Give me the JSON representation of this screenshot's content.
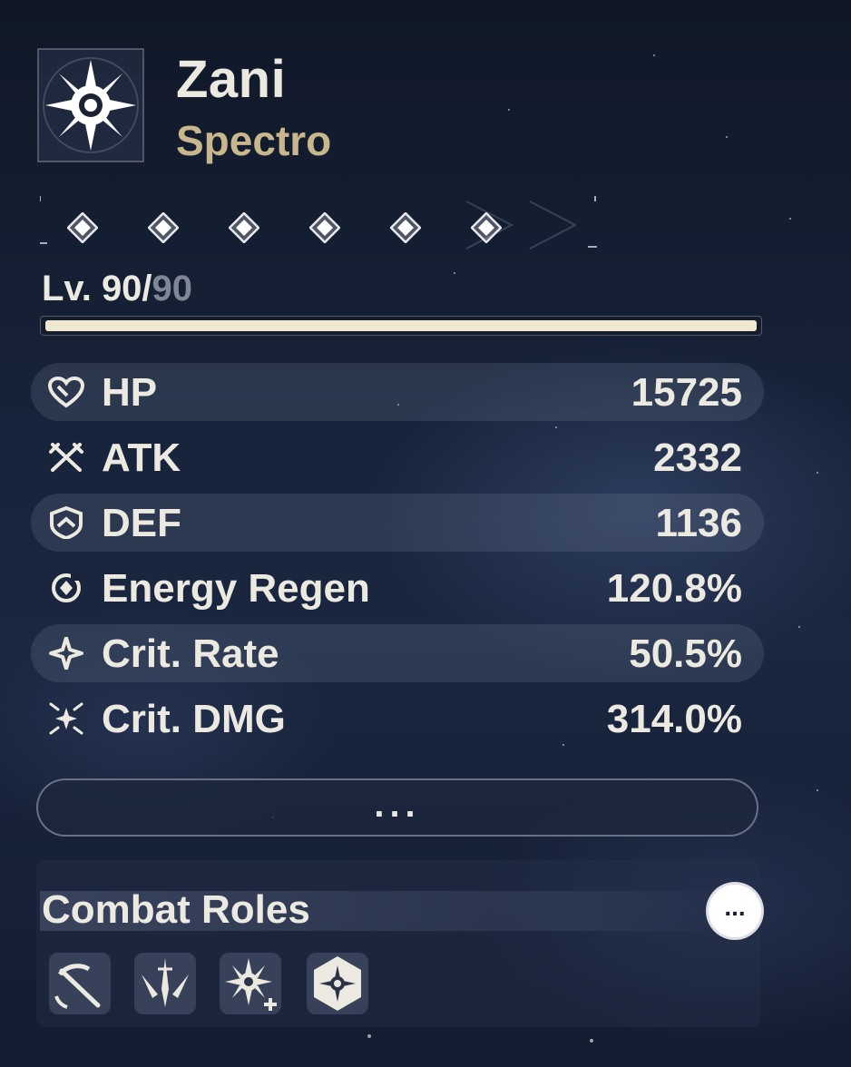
{
  "character": {
    "name": "Zani",
    "element": "Spectro",
    "emblem_icon": "spectro-sun-icon"
  },
  "sequence": {
    "nodes_unlocked": 6,
    "nodes_total": 6
  },
  "level": {
    "current": "Lv. 90/",
    "max": "90",
    "progress": 1.0
  },
  "stats": [
    {
      "label": "HP",
      "value": "15725",
      "icon": "heart-icon"
    },
    {
      "label": "ATK",
      "value": "2332",
      "icon": "crossed-swords-icon"
    },
    {
      "label": "DEF",
      "value": "1136",
      "icon": "shield-icon"
    },
    {
      "label": "Energy Regen",
      "value": "120.8%",
      "icon": "energy-regen-icon"
    },
    {
      "label": "Crit. Rate",
      "value": "50.5%",
      "icon": "crit-rate-icon"
    },
    {
      "label": "Crit. DMG",
      "value": "314.0%",
      "icon": "crit-dmg-icon"
    }
  ],
  "more_button_label": "...",
  "combat_roles": {
    "title": "Combat Roles",
    "more_label": "...",
    "roles": [
      {
        "icon": "sword-slash-icon"
      },
      {
        "icon": "blade-burst-icon"
      },
      {
        "icon": "sun-plus-icon"
      },
      {
        "icon": "hexagon-sun-icon"
      }
    ]
  }
}
